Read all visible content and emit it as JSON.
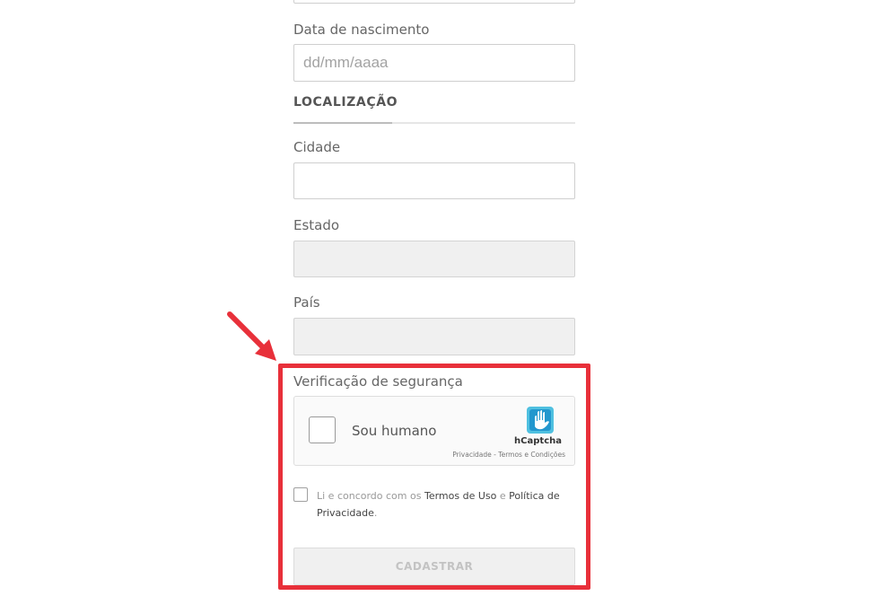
{
  "form": {
    "birthdate": {
      "label": "Data de nascimento",
      "placeholder": "dd/mm/aaaa",
      "value": ""
    },
    "location_section": {
      "title": "LOCALIZAÇÃO"
    },
    "city": {
      "label": "Cidade",
      "value": ""
    },
    "state": {
      "label": "Estado",
      "value": ""
    },
    "country": {
      "label": "País",
      "value": ""
    },
    "security": {
      "label": "Verificação de segurança",
      "captcha": {
        "checkbox_label": "Sou humano",
        "brand": "hCaptcha",
        "privacy_link": "Privacidade",
        "separator": " - ",
        "terms_link": "Termos e Condições",
        "logo_icon": "hcaptcha-hand-icon"
      }
    },
    "terms": {
      "prefix": "Li e concordo com os ",
      "terms_link": "Termos de Uso",
      "conjunction": " e ",
      "privacy_link": "Política de Privacidade",
      "suffix": "."
    },
    "submit_label": "CADASTRAR"
  },
  "annotation": {
    "highlight_color": "#e8303a",
    "arrow_icon": "red-arrow-icon"
  },
  "colors": {
    "hcaptcha_blue": "#4fc0e0",
    "hcaptcha_dark": "#0074bf"
  }
}
